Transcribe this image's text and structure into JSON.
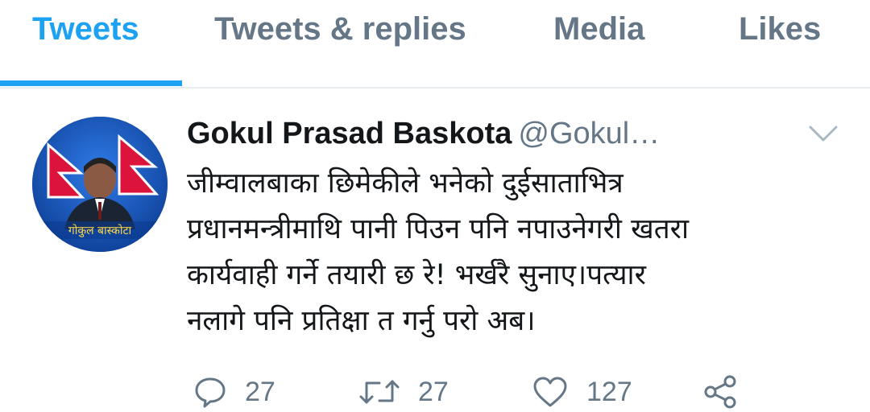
{
  "tabs": [
    {
      "label": "Tweets",
      "active": true
    },
    {
      "label": "Tweets & replies",
      "active": false
    },
    {
      "label": "Media",
      "active": false
    },
    {
      "label": "Likes",
      "active": false
    }
  ],
  "tweet": {
    "author_name": "Gokul Prasad Baskota",
    "author_handle": "@Gokul…",
    "avatar_caption": "गोकुल बास्कोटा",
    "lines": [
      "जीम्वालबाका छिमेकीले भनेको दुईसाताभित्र",
      "प्रधानमन्त्रीमाथि पानी पिउन पनि नपाउनेगरी खतरा",
      "कार्यवाही गर्ने तयारी छ रे! भर्खरै सुनाए।पत्यार",
      "नलागे पनि प्रतिक्षा त गर्नु परो अब।"
    ],
    "actions": {
      "reply_count": "27",
      "retweet_count": "27",
      "like_count": "127"
    }
  },
  "icons": {
    "reply": "reply-icon",
    "retweet": "retweet-icon",
    "like": "heart-icon",
    "share": "share-icon",
    "menu": "chevron-down-icon"
  },
  "colors": {
    "accent": "#1da1f2",
    "text": "#14171a",
    "muted": "#657786",
    "divider": "#e6ecf0"
  }
}
